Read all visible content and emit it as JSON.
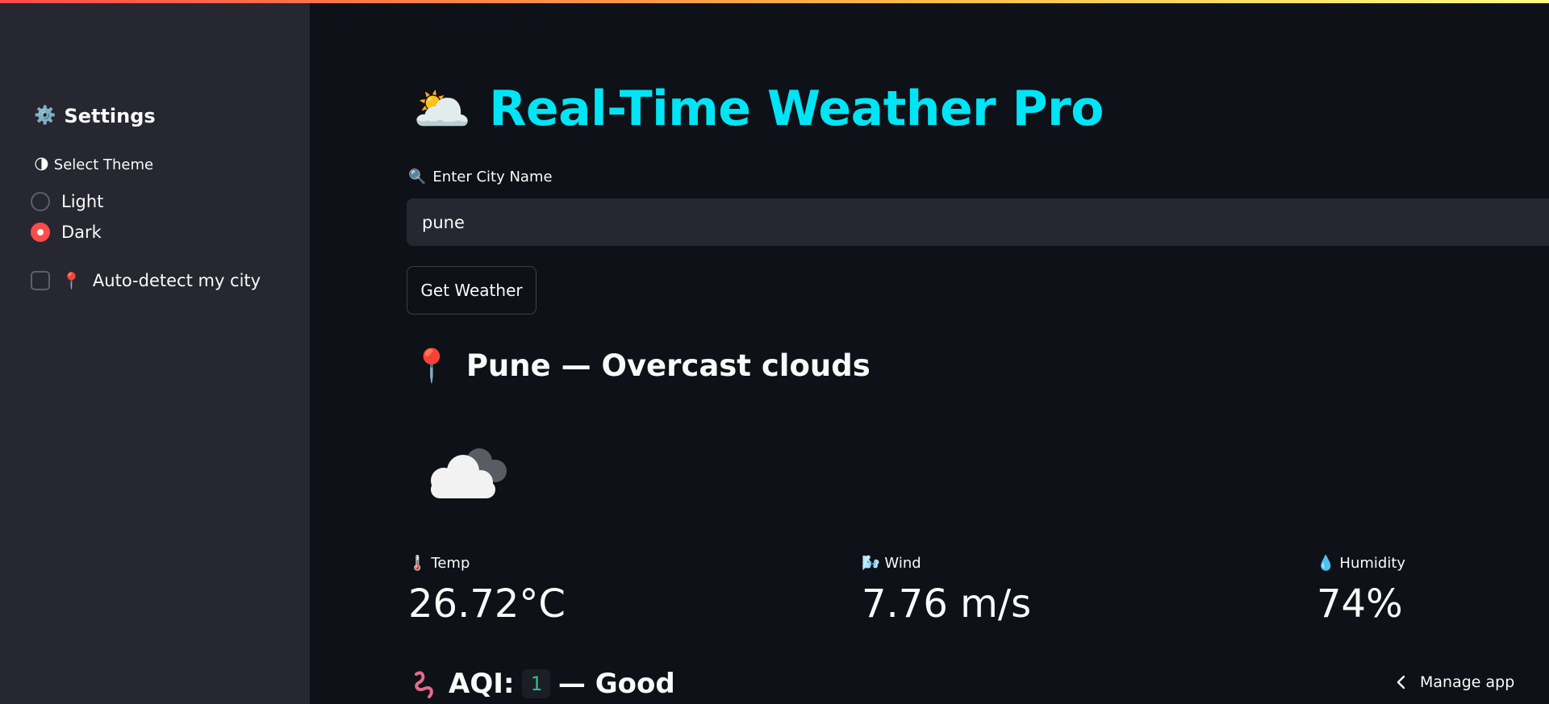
{
  "sidebar": {
    "header": {
      "icon": "gear-icon",
      "icon_glyph": "⚙️",
      "label": "Settings"
    },
    "theme": {
      "icon": "half-moon-icon",
      "icon_glyph": "🌗",
      "label": "Select Theme",
      "options": [
        {
          "label": "Light",
          "checked": false
        },
        {
          "label": "Dark",
          "checked": true
        }
      ]
    },
    "autodetect": {
      "icon": "pin-icon",
      "icon_glyph": "📍",
      "label": "Auto-detect my city",
      "checked": false
    }
  },
  "main": {
    "title": {
      "icon": "sun-behind-cloud-icon",
      "icon_glyph": "🌥️",
      "text": "Real-Time Weather Pro"
    },
    "city_input": {
      "icon": "magnifier-icon",
      "icon_glyph": "🔍",
      "label": "Enter City Name",
      "value": "pune"
    },
    "get_button_label": "Get Weather",
    "city_heading": {
      "icon": "pin-icon",
      "icon_glyph": "📍",
      "text": "Pune — Overcast clouds"
    },
    "weather_icon": "overcast-clouds-icon",
    "metrics": [
      {
        "icon": "thermometer-icon",
        "icon_glyph": "🌡️",
        "label": "Temp",
        "value": "26.72°C"
      },
      {
        "icon": "wind-icon",
        "icon_glyph": "🌬️",
        "label": "Wind",
        "value": "7.76 m/s"
      },
      {
        "icon": "droplet-icon",
        "icon_glyph": "💧",
        "label": "Humidity",
        "value": "74%"
      }
    ],
    "aqi": {
      "icon": "squiggle-icon",
      "icon_glyph": "〰",
      "label": "AQI:",
      "code": "1",
      "suffix": "— Good"
    }
  },
  "footer": {
    "manage_app_label": "Manage app"
  },
  "colors": {
    "background": "#0e1117",
    "sidebar": "#262730",
    "title_accent": "#00e5f5",
    "radio_accent": "#ff4b4b",
    "aqi_code": "#2ec27e"
  }
}
